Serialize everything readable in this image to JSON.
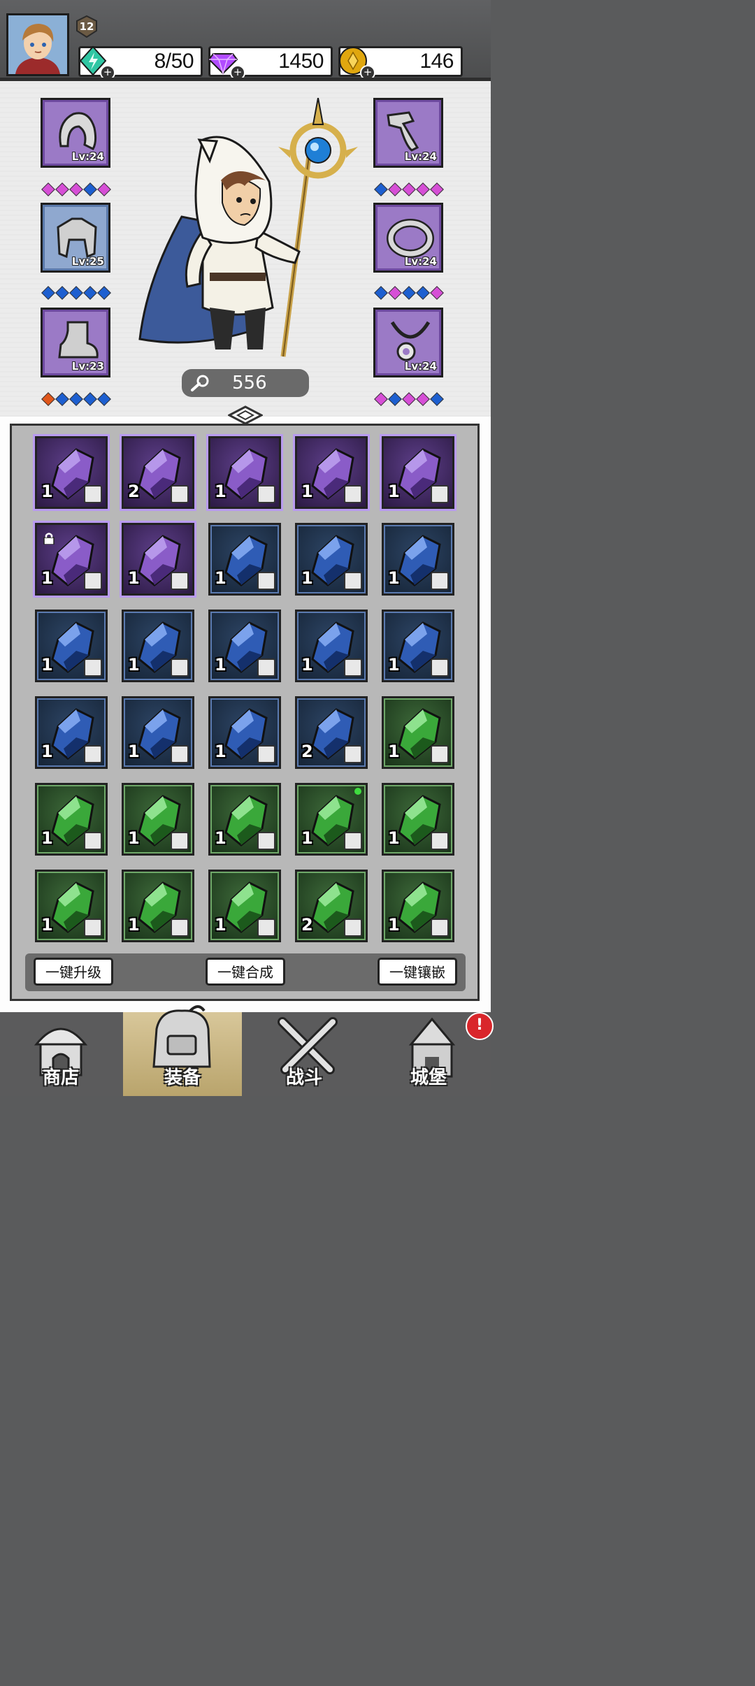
{
  "player": {
    "level": "12",
    "resources": [
      {
        "name": "energy",
        "value": "8/50",
        "icon": "energy-gem-icon",
        "color": "#2fc6a3"
      },
      {
        "name": "diamonds",
        "value": "1450",
        "icon": "diamond-icon",
        "color": "#b14cff"
      },
      {
        "name": "gold",
        "value": "146",
        "icon": "gold-coin-icon",
        "color": "#e0a70f"
      }
    ]
  },
  "equipment": {
    "left": [
      {
        "slot": "helmet",
        "level": "Lv:24",
        "rarity": "purple",
        "sockets": [
          "pink",
          "pink",
          "pink",
          "blue",
          "pink"
        ]
      },
      {
        "slot": "armor",
        "level": "Lv:25",
        "rarity": "blue",
        "sockets": [
          "blue",
          "blue",
          "blue",
          "blue",
          "blue"
        ]
      },
      {
        "slot": "boots",
        "level": "Lv:23",
        "rarity": "purple",
        "sockets": [
          "orange",
          "blue",
          "blue",
          "blue",
          "blue"
        ]
      }
    ],
    "right": [
      {
        "slot": "gloves",
        "level": "Lv:24",
        "rarity": "purple",
        "sockets": [
          "blue",
          "pink",
          "pink",
          "pink",
          "pink"
        ]
      },
      {
        "slot": "ring",
        "level": "Lv:24",
        "rarity": "purple",
        "sockets": [
          "blue",
          "pink",
          "blue",
          "blue",
          "pink"
        ]
      },
      {
        "slot": "amulet",
        "level": "Lv:24",
        "rarity": "purple",
        "sockets": [
          "pink",
          "blue",
          "pink",
          "pink",
          "blue"
        ]
      }
    ]
  },
  "power": {
    "value": "556",
    "icon": "wrench-icon"
  },
  "inventory": [
    {
      "rarity": "purple",
      "count": "1",
      "slot": "helmet"
    },
    {
      "rarity": "purple",
      "count": "2",
      "slot": "helmet"
    },
    {
      "rarity": "purple",
      "count": "1",
      "slot": "boots"
    },
    {
      "rarity": "purple",
      "count": "1",
      "slot": "gloves"
    },
    {
      "rarity": "purple",
      "count": "1",
      "slot": "ring"
    },
    {
      "rarity": "purple",
      "count": "1",
      "slot": "amulet",
      "locked": true
    },
    {
      "rarity": "purple",
      "count": "1",
      "slot": "amulet"
    },
    {
      "rarity": "blue",
      "count": "1",
      "slot": "helmet"
    },
    {
      "rarity": "blue",
      "count": "1",
      "slot": "armor"
    },
    {
      "rarity": "blue",
      "count": "1",
      "slot": "armor"
    },
    {
      "rarity": "blue",
      "count": "1",
      "slot": "armor"
    },
    {
      "rarity": "blue",
      "count": "1",
      "slot": "armor"
    },
    {
      "rarity": "blue",
      "count": "1",
      "slot": "boots"
    },
    {
      "rarity": "blue",
      "count": "1",
      "slot": "boots"
    },
    {
      "rarity": "blue",
      "count": "1",
      "slot": "gloves"
    },
    {
      "rarity": "blue",
      "count": "1",
      "slot": "gloves"
    },
    {
      "rarity": "blue",
      "count": "1",
      "slot": "ring"
    },
    {
      "rarity": "blue",
      "count": "1",
      "slot": "amulet"
    },
    {
      "rarity": "blue",
      "count": "2",
      "slot": "amulet"
    },
    {
      "rarity": "green",
      "count": "1",
      "slot": "helmet"
    },
    {
      "rarity": "green",
      "count": "1",
      "slot": "armor"
    },
    {
      "rarity": "green",
      "count": "1",
      "slot": "boots"
    },
    {
      "rarity": "green",
      "count": "1",
      "slot": "boots"
    },
    {
      "rarity": "green",
      "count": "1",
      "slot": "gloves",
      "new": true
    },
    {
      "rarity": "green",
      "count": "1",
      "slot": "gloves"
    },
    {
      "rarity": "green",
      "count": "1",
      "slot": "gloves"
    },
    {
      "rarity": "green",
      "count": "1",
      "slot": "gloves"
    },
    {
      "rarity": "green",
      "count": "1",
      "slot": "ring"
    },
    {
      "rarity": "green",
      "count": "2",
      "slot": "ring"
    },
    {
      "rarity": "green",
      "count": "1",
      "slot": "amulet"
    }
  ],
  "actions": {
    "upgrade_all": "一键升级",
    "merge_all": "一键合成",
    "inlay_all": "一键镶嵌"
  },
  "nav": {
    "shop": "商店",
    "equipment": "装备",
    "battle": "战斗",
    "castle": "城堡",
    "castle_alert": "!"
  },
  "colors": {
    "purple": "#b99bf0",
    "blue": "#5a7ab0",
    "green": "#6ea868",
    "pink": "#d64fd6",
    "socket_blue": "#1d5fd0",
    "orange": "#e0561a"
  }
}
